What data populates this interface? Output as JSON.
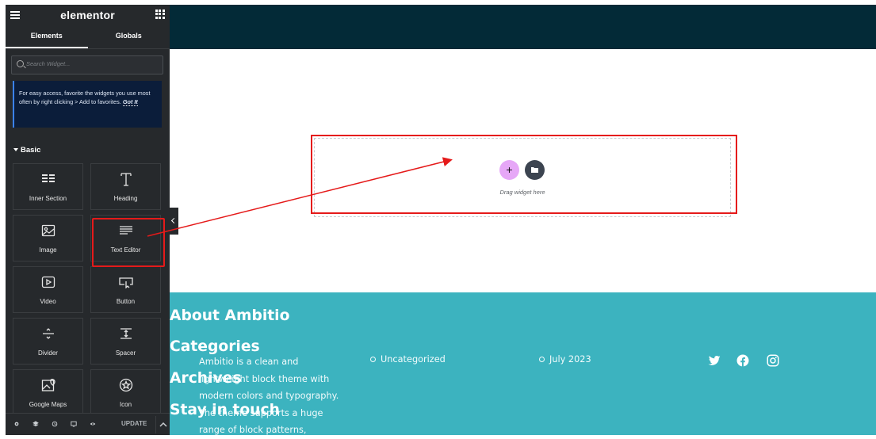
{
  "panel": {
    "brand": "elementor",
    "tabs": [
      "Elements",
      "Globals"
    ],
    "search_placeholder": "Search Widget...",
    "tip": {
      "text": "For easy access, favorite the widgets you use most often by right clicking > Add to favorites.",
      "link": "Got It"
    },
    "category": "Basic",
    "widgets": [
      {
        "label": "Inner Section",
        "icon": "inner-section-icon"
      },
      {
        "label": "Heading",
        "icon": "heading-icon"
      },
      {
        "label": "Image",
        "icon": "image-icon"
      },
      {
        "label": "Text Editor",
        "icon": "text-editor-icon"
      },
      {
        "label": "Video",
        "icon": "video-icon"
      },
      {
        "label": "Button",
        "icon": "button-icon"
      },
      {
        "label": "Divider",
        "icon": "divider-icon"
      },
      {
        "label": "Spacer",
        "icon": "spacer-icon"
      },
      {
        "label": "Google Maps",
        "icon": "google-maps-icon"
      },
      {
        "label": "Icon",
        "icon": "star-icon"
      }
    ],
    "footer": {
      "update_label": "UPDATE"
    }
  },
  "canvas": {
    "drop_text": "Drag widget here",
    "plus_glyph": "+"
  },
  "site_footer": {
    "about": {
      "title": "About Ambitio",
      "text": "Ambitio is a clean and lightweight block theme with modern colors and typography. The theme supports a huge range of block patterns,"
    },
    "categories": {
      "title": "Categories",
      "items": [
        "Uncategorized"
      ]
    },
    "archives": {
      "title": "Archives",
      "items": [
        "July 2023"
      ]
    },
    "stay": {
      "title": "Stay in touch",
      "icons": [
        "twitter-icon",
        "facebook-icon",
        "instagram-icon"
      ]
    }
  },
  "colors": {
    "panel_bg": "#26292c",
    "header_bg": "#032a37",
    "footer_bg": "#3cb3bf",
    "annotation_red": "#e51a1a",
    "plus_bg": "#e6a7f7"
  }
}
